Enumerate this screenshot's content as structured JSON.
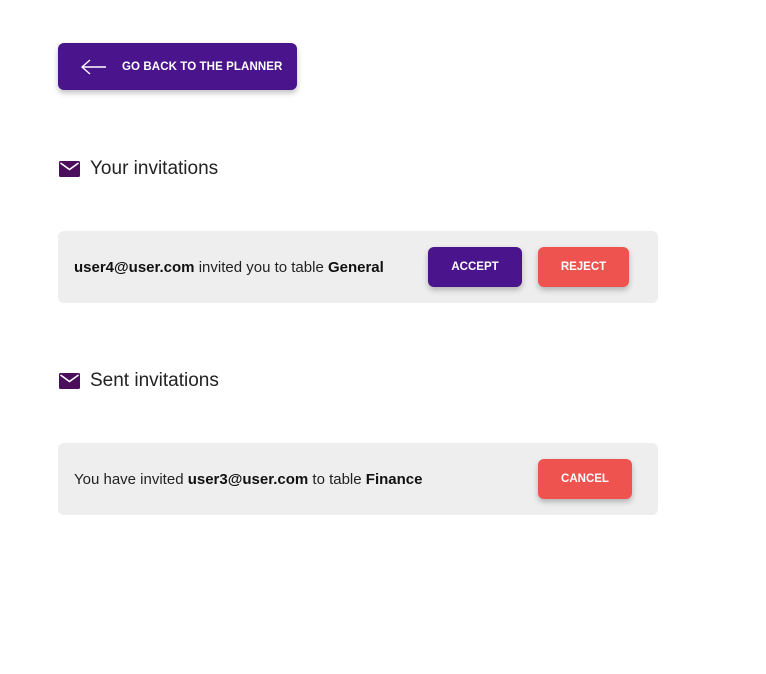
{
  "back_button": {
    "label": "GO BACK TO THE PLANNER",
    "icon": "arrow-left-icon"
  },
  "your_invitations": {
    "heading": "Your invitations",
    "icon": "mail-icon",
    "items": [
      {
        "from_user": "user4@user.com",
        "middle_text": " invited you to table ",
        "table": "General",
        "accept_label": "ACCEPT",
        "reject_label": "REJECT"
      }
    ]
  },
  "sent_invitations": {
    "heading": "Sent invitations",
    "icon": "mail-icon",
    "items": [
      {
        "prefix_text": "You have invited ",
        "to_user": "user3@user.com",
        "middle_text": " to table ",
        "table": "Finance",
        "cancel_label": "CANCEL"
      }
    ]
  },
  "colors": {
    "primary": "#4a148c",
    "danger": "#ef5350",
    "card_background": "#eeeeee"
  }
}
